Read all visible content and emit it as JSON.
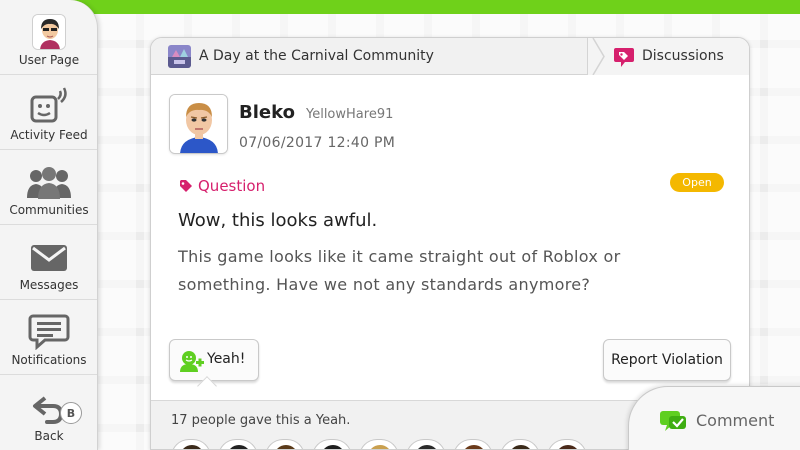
{
  "sidebar": {
    "user_page": "User Page",
    "activity_feed": "Activity Feed",
    "communities": "Communities",
    "messages": "Messages",
    "notifications": "Notifications",
    "back": "Back",
    "back_badge": "B"
  },
  "header": {
    "community_title": "A Day at the Carnival Community",
    "discussions_label": "Discussions"
  },
  "post": {
    "author_name": "Bleko",
    "author_id": "YellowHare91",
    "timestamp": "07/06/2017 12:40 PM",
    "tag": "Question",
    "status": "Open",
    "title": "Wow, this looks awful.",
    "body": "This game looks like it came straight out of Roblox or something. Have we not any standards anymore?"
  },
  "actions": {
    "yeah_label": "Yeah!",
    "report_label": "Report Violation",
    "comment_label": "Comment"
  },
  "yeahs": {
    "count_text": "17 people gave this a Yeah."
  },
  "colors": {
    "accent_green": "#6fd11a",
    "question_pink": "#d6206d",
    "open_yellow": "#f4b800"
  }
}
